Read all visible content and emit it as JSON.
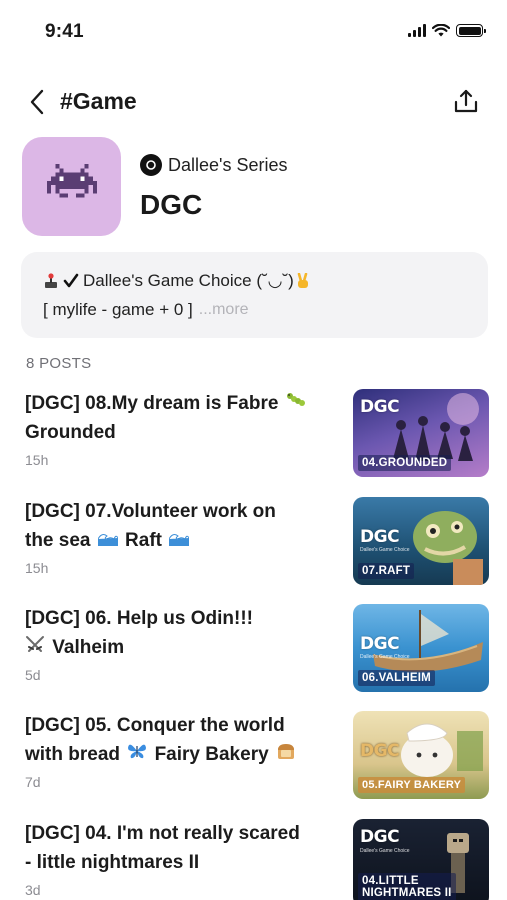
{
  "status": {
    "time": "9:41"
  },
  "nav": {
    "title": "#Game"
  },
  "series": {
    "owner": "Dallee's Series",
    "name": "DGC"
  },
  "description": {
    "line1": "Dallee's Game Choice (˘◡˘)",
    "line2": "[ mylife - game + 0 ]",
    "more": "...more"
  },
  "posts_count": "8 POSTS",
  "posts": [
    {
      "title_a": "[DGC] 08.My dream is Fabre",
      "title_b": "Grounded",
      "time": "15h",
      "thumb_label": "04.GROUNDED",
      "thumb_logo": "DGC",
      "colors": [
        "#3b3a8f",
        "#a86fc4"
      ]
    },
    {
      "title_a": "[DGC] 07.Volunteer work on",
      "title_b": "the sea",
      "title_c": "Raft",
      "time": "15h",
      "thumb_label": "07.RAFT",
      "thumb_logo": "DGC",
      "thumb_sub": "Dallee's Game Choice",
      "colors": [
        "#1f5d86",
        "#7fb06a"
      ]
    },
    {
      "title_a": "[DGC] 06. Help us Odin!!!",
      "title_b": "Valheim",
      "time": "5d",
      "thumb_label": "06.VALHEIM",
      "thumb_logo": "DGC",
      "thumb_sub": "Dallee's Game Choice",
      "colors": [
        "#2c86c8",
        "#c7a472"
      ]
    },
    {
      "title_a": "[DGC] 05. Conquer the world",
      "title_b": "with bread",
      "title_c": "Fairy Bakery",
      "time": "7d",
      "thumb_label": "05.FAIRY BAKERY",
      "thumb_logo": "DGC",
      "colors": [
        "#e8d9a8",
        "#9aa35a"
      ]
    },
    {
      "title_a": "[DGC] 04. I'm not really scared",
      "title_b": "- little nightmares II",
      "time": "3d",
      "thumb_label_1": "04.LITTLE",
      "thumb_label_2": "NIGHTMARES II",
      "thumb_logo": "DGC",
      "thumb_sub": "Dallee's Game Choice",
      "colors": [
        "#0e1420",
        "#4a5568"
      ]
    }
  ],
  "icons": {
    "back": "chevron-left-icon",
    "share": "share-icon",
    "owner": "series-owner-icon",
    "alien": "pixel-alien-icon"
  }
}
